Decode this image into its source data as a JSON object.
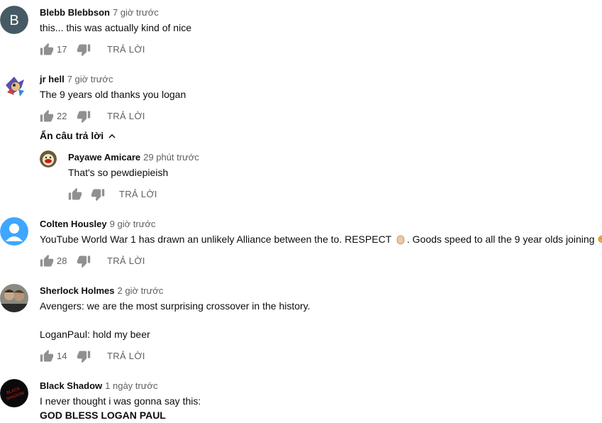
{
  "comments": [
    {
      "author": "Blebb Blebbson",
      "time": "7 giờ trước",
      "text": "this... this was actually kind of nice",
      "likes": "17",
      "reply": "TRẢ LỜI",
      "avatar_letter": "B"
    },
    {
      "author": "jr hell",
      "time": "7 giờ trước",
      "text": "The 9 years old thanks you logan",
      "likes": "22",
      "reply": "TRẢ LỜI"
    },
    {
      "author": "Colten Housley",
      "time": "9 giờ trước",
      "text_before": "YouTube World War 1 has drawn an unlikely Alliance between the to. RESPECT",
      "text_middle": ". Goods speed to all the 9 year olds joining",
      "likes": "28",
      "reply": "TRẢ LỜI"
    },
    {
      "author": "Sherlock Holmes",
      "time": "2 giờ trước",
      "line1": "Avengers: we are the most surprising crossover in the history.",
      "line2": "LoganPaul: hold my beer",
      "likes": "14",
      "reply": "TRẢ LỜI"
    },
    {
      "author": "Black Shadow",
      "time": "1 ngày trước",
      "line1": "I never thought i was gonna say this:",
      "line2": "GOD BLESS LOGAN PAUL",
      "avatar_text": "BLACK SHADOW"
    }
  ],
  "replies_toggle": "Ẩn câu trả lời",
  "reply_comment": {
    "author": "Payawe Amicare",
    "time": "29 phút trước",
    "text": "That's so pewdiepieish",
    "reply": "TRẢ LỜI"
  },
  "colors": {
    "muted": "#606060",
    "icon": "#909090",
    "avatar_b": "#455a64",
    "avatar_blue": "#3ea6ff"
  },
  "icons": [
    "thumb-up-icon",
    "thumb-down-icon",
    "chevron-up-icon",
    "hand-emoji-icon",
    "handshake-emoji-icon"
  ]
}
